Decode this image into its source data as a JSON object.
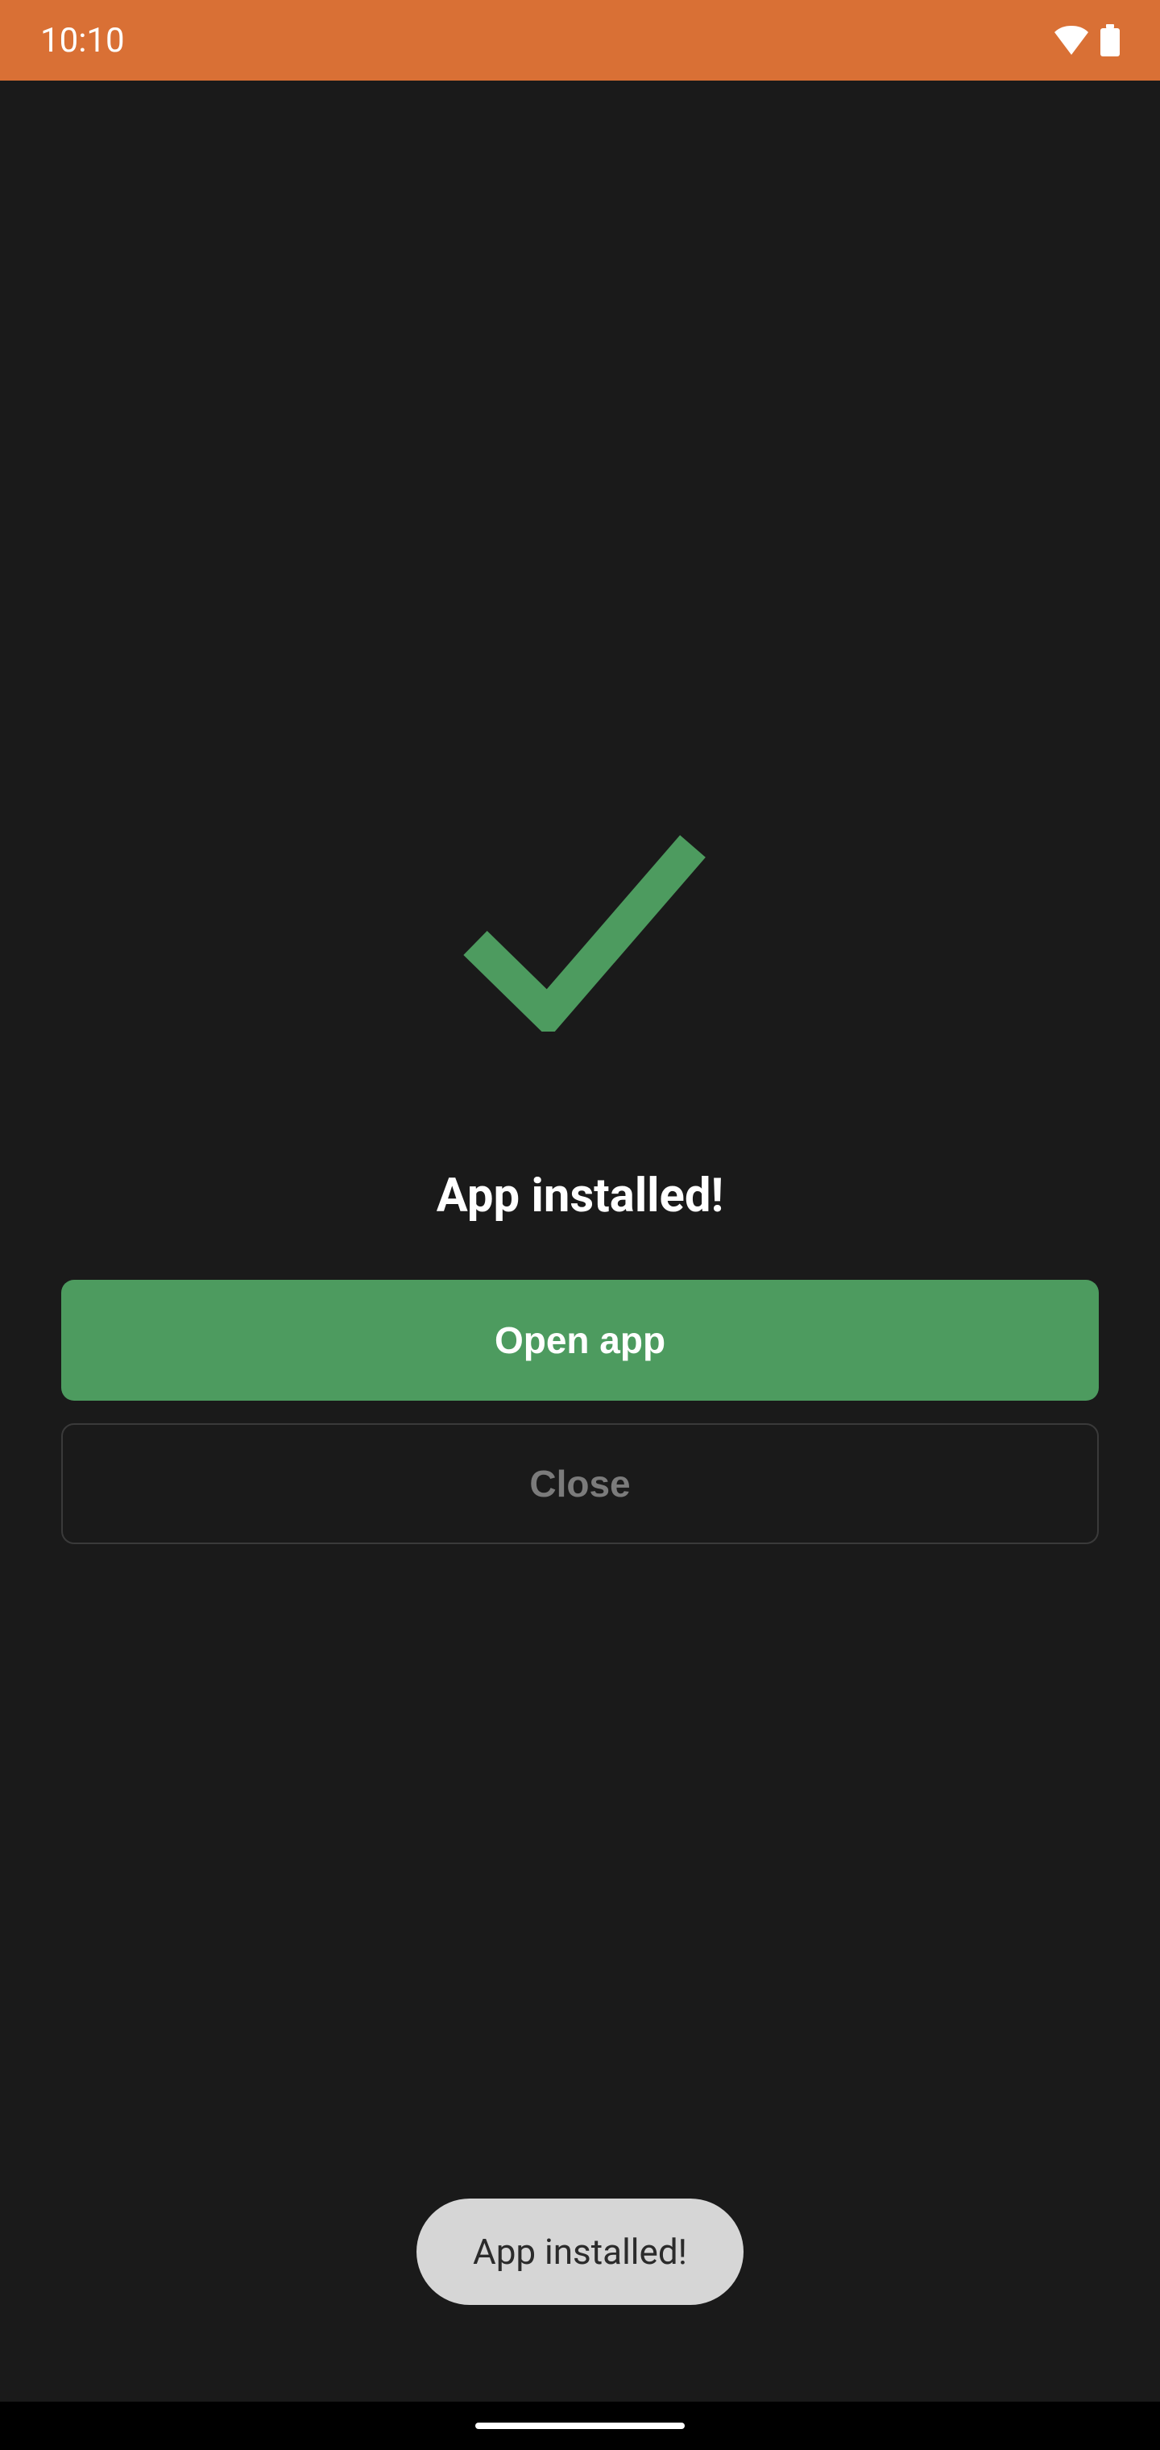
{
  "status": {
    "time": "10:10"
  },
  "main": {
    "title": "App installed!",
    "open_button_label": "Open app",
    "close_button_label": "Close"
  },
  "toast": {
    "message": "App installed!"
  },
  "colors": {
    "status_bar": "#d97035",
    "background": "#1a1a1a",
    "primary_green": "#4d9b5f",
    "checkmark": "#4d9b5f",
    "toast_bg": "#d6d6d6"
  }
}
